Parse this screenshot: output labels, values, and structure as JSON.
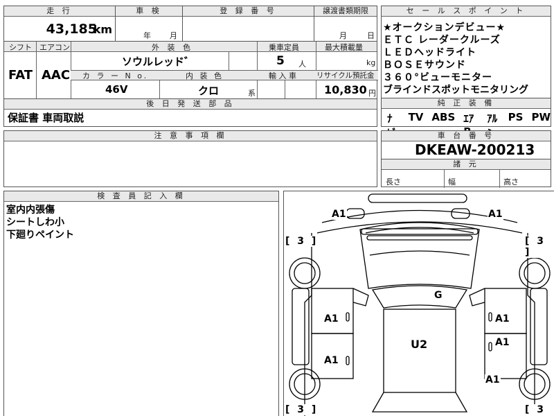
{
  "top": {
    "mileage_label": "走 行",
    "mileage_value": "43,185",
    "mileage_unit": "km",
    "shaken_label": "車 検",
    "shaken_year": "年",
    "shaken_month": "月",
    "registration_label": "登 録 番 号",
    "transfer_label": "譲渡書類期限",
    "transfer_month": "月",
    "transfer_day": "日"
  },
  "row2": {
    "shift_label": "シフト",
    "aircon_label": "エアコン",
    "exterior_label": "外 装 色",
    "capacity_label": "乗車定員",
    "maxload_label": "最大積載量",
    "shift_value": "FAT",
    "aircon_value": "AAC",
    "exterior_value": "ソウルレッド゛",
    "capacity_value": "5",
    "capacity_unit": "人",
    "maxload_unit": "kg",
    "color_no_label": "カ ラ ー N o.",
    "interior_label": "内 装 色",
    "import_label": "輸 入 車",
    "recycle_label": "リサイクル預託金",
    "color_no_value": "46V",
    "interior_value": "クロ",
    "interior_suffix": "系",
    "recycle_value": "10,830",
    "recycle_unit": "円"
  },
  "later_parts": {
    "label": "後 日 発 送 部 品",
    "value": "保証書 車両取説"
  },
  "caution": {
    "label": "注 意 事 項 欄"
  },
  "sales_points": {
    "label": "セ ー ル ス ポ イ ン ト",
    "items": [
      "★オークションデビュー★",
      "ＥＴＣ レーダークルーズ",
      "ＬＥＤヘッドライト",
      "ＢＯＳＥサウンド",
      "３６０°ビューモニター",
      "ブラインドスポットモニタリング"
    ]
  },
  "equipment": {
    "label": "純 正 装 備",
    "items": [
      "ﾅﾋﾞ",
      "TV",
      "ABS",
      "ｴｱB",
      "ｱﾙﾐ",
      "PS",
      "PW"
    ]
  },
  "chassis": {
    "label": "車 台 番 号",
    "value": "DKEAW-200213"
  },
  "dimensions": {
    "label": "諸 元",
    "length": "長さ",
    "width": "幅",
    "height": "高さ"
  },
  "inspector": {
    "label": "検 査 員 記 入 欄",
    "lines": [
      "室内内張傷",
      "シートしわ小",
      "下廻りペイント"
    ]
  },
  "diagram": {
    "marks": {
      "front_left": "A1",
      "front_right": "A1",
      "bracket_fl": "[ 3 ]",
      "bracket_fr": "[ 3 ]",
      "bracket_rl": "[ 3 ]",
      "bracket_rr": "[ 3 ]",
      "hood": "G",
      "roof": "U2",
      "left_front_door": "A1",
      "left_rear_door": "A1",
      "right_front_door": "A1",
      "right_rear_door": "A1",
      "right_rear_fender": "A1"
    }
  }
}
